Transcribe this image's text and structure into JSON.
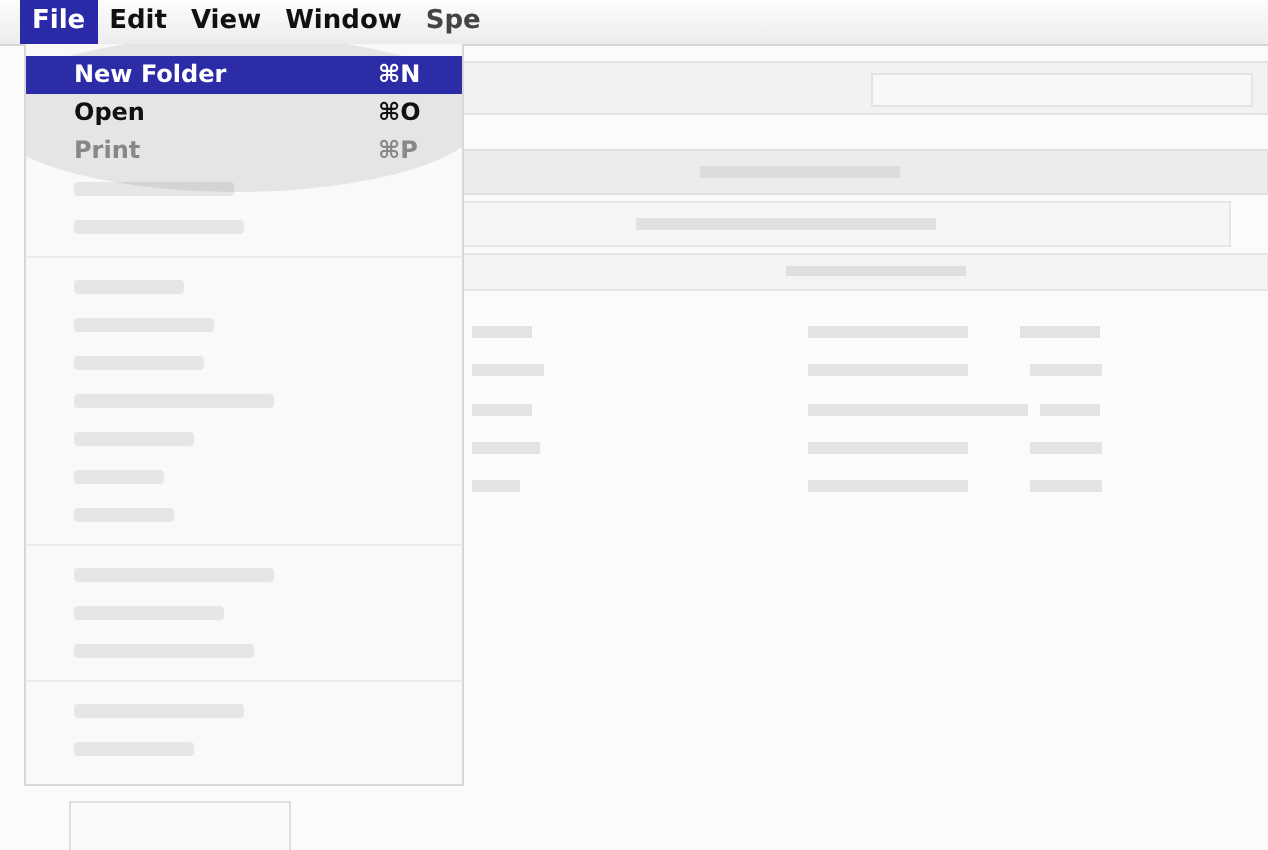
{
  "menu_bar": [
    {
      "label": "File",
      "selected": true
    },
    {
      "label": "Edit",
      "selected": false
    },
    {
      "label": "View",
      "selected": false
    },
    {
      "label": "Window",
      "selected": false
    },
    {
      "label": "Spe",
      "selected": false
    }
  ],
  "file_menu": {
    "items": [
      {
        "label": "New Folder",
        "shortcut": "⌘N",
        "selected": true,
        "disabled": false
      },
      {
        "label": "Open",
        "shortcut": "⌘O",
        "selected": false,
        "disabled": false
      },
      {
        "label": "Print",
        "shortcut": "⌘P",
        "selected": false,
        "disabled": true
      }
    ],
    "faded_items": [
      {
        "kind": "item"
      },
      {
        "kind": "item"
      },
      {
        "kind": "separator"
      },
      {
        "kind": "item"
      },
      {
        "kind": "item"
      },
      {
        "kind": "item"
      },
      {
        "kind": "item"
      },
      {
        "kind": "item"
      },
      {
        "kind": "item"
      },
      {
        "kind": "item"
      },
      {
        "kind": "separator"
      },
      {
        "kind": "item"
      },
      {
        "kind": "item"
      },
      {
        "kind": "item"
      },
      {
        "kind": "separator"
      },
      {
        "kind": "item"
      },
      {
        "kind": "item"
      }
    ]
  }
}
